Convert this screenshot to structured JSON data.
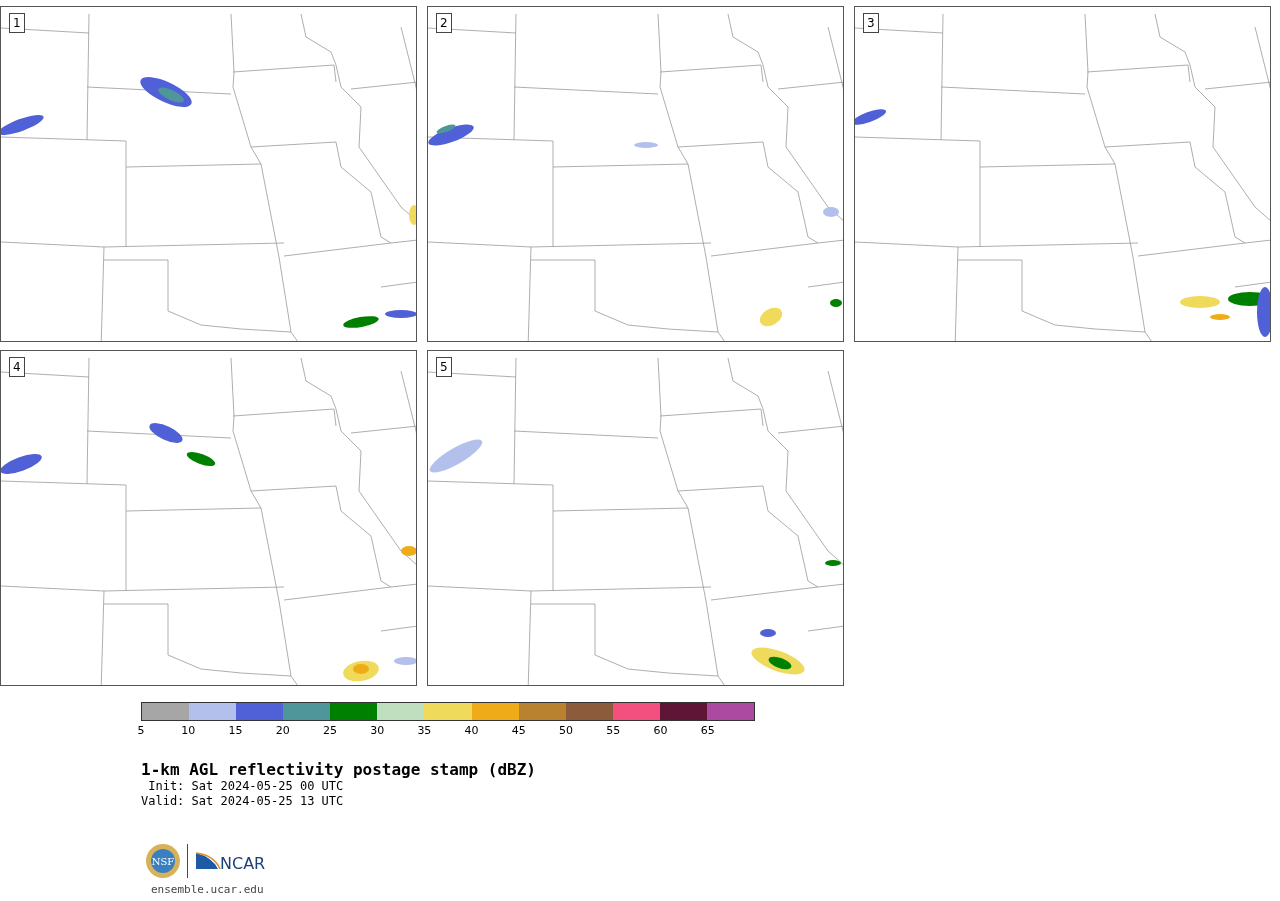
{
  "panels": [
    {
      "label": "1"
    },
    {
      "label": "2"
    },
    {
      "label": "3"
    },
    {
      "label": "4"
    },
    {
      "label": "5"
    }
  ],
  "colorbar": {
    "bins": [
      {
        "color": "#a6a6a6"
      },
      {
        "color": "#b4c0ec"
      },
      {
        "color": "#5060d6"
      },
      {
        "color": "#4f969a"
      },
      {
        "color": "#008000"
      },
      {
        "color": "#bfdfbf"
      },
      {
        "color": "#f0da5c"
      },
      {
        "color": "#f0ac18"
      },
      {
        "color": "#b9822f"
      },
      {
        "color": "#8b5b3c"
      },
      {
        "color": "#f4507f"
      },
      {
        "color": "#5f1535"
      },
      {
        "color": "#ab4aa0"
      }
    ],
    "ticks": [
      "5",
      "10",
      "15",
      "20",
      "25",
      "30",
      "35",
      "40",
      "45",
      "50",
      "55",
      "60",
      "65"
    ]
  },
  "title": "1-km AGL reflectivity postage stamp (dBZ)",
  "init": " Init: Sat 2024-05-25 00 UTC",
  "valid": "Valid: Sat 2024-05-25 13 UTC",
  "logo": {
    "seal_text": "NSF",
    "wordmark": "NCAR"
  },
  "url": "ensemble.ucar.edu"
}
